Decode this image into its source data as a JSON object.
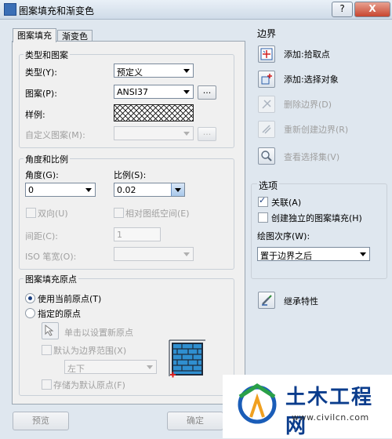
{
  "window": {
    "title": "图案填充和渐变色",
    "help_label": "?",
    "close_label": "X"
  },
  "tabs": [
    {
      "label": "图案填充",
      "active": true
    },
    {
      "label": "渐变色",
      "active": false
    }
  ],
  "type_pattern": {
    "legend": "类型和图案",
    "type_label": "类型(Y):",
    "type_value": "预定义",
    "pattern_label": "图案(P):",
    "pattern_value": "ANSI37",
    "dots": "...",
    "swatch_label": "样例:",
    "custom_label": "自定义图案(M):",
    "custom_value": ""
  },
  "angle_scale": {
    "legend": "角度和比例",
    "angle_label": "角度(G):",
    "angle_value": "0",
    "scale_label": "比例(S):",
    "scale_value": "0.02",
    "double_label": "双向(U)",
    "relative_label": "相对图纸空间(E)",
    "spacing_label": "间距(C):",
    "spacing_value": "1",
    "iso_label": "ISO 笔宽(O):",
    "iso_value": ""
  },
  "origin": {
    "legend": "图案填充原点",
    "use_current_label": "使用当前原点(T)",
    "specified_label": "指定的原点",
    "click_set_label": "单击以设置新原点",
    "default_extent_label": "默认为边界范围(X)",
    "extent_value": "左下",
    "store_default_label": "存储为默认原点(F)"
  },
  "boundaries": {
    "title": "边界",
    "add_pick": "添加:拾取点",
    "add_select": "添加:选择对象",
    "remove": "删除边界(D)",
    "recreate": "重新创建边界(R)",
    "view_selection": "查看选择集(V)"
  },
  "options": {
    "title": "选项",
    "associative_label": "关联(A)",
    "separate_label": "创建独立的图案填充(H)",
    "draw_order_label": "绘图次序(W):",
    "draw_order_value": "置于边界之后"
  },
  "inherit_label": "继承特性",
  "bottom": {
    "preview": "预览",
    "ok": "确定"
  },
  "watermark": {
    "title": "土木工程网",
    "url": "www.civilcn.com"
  }
}
